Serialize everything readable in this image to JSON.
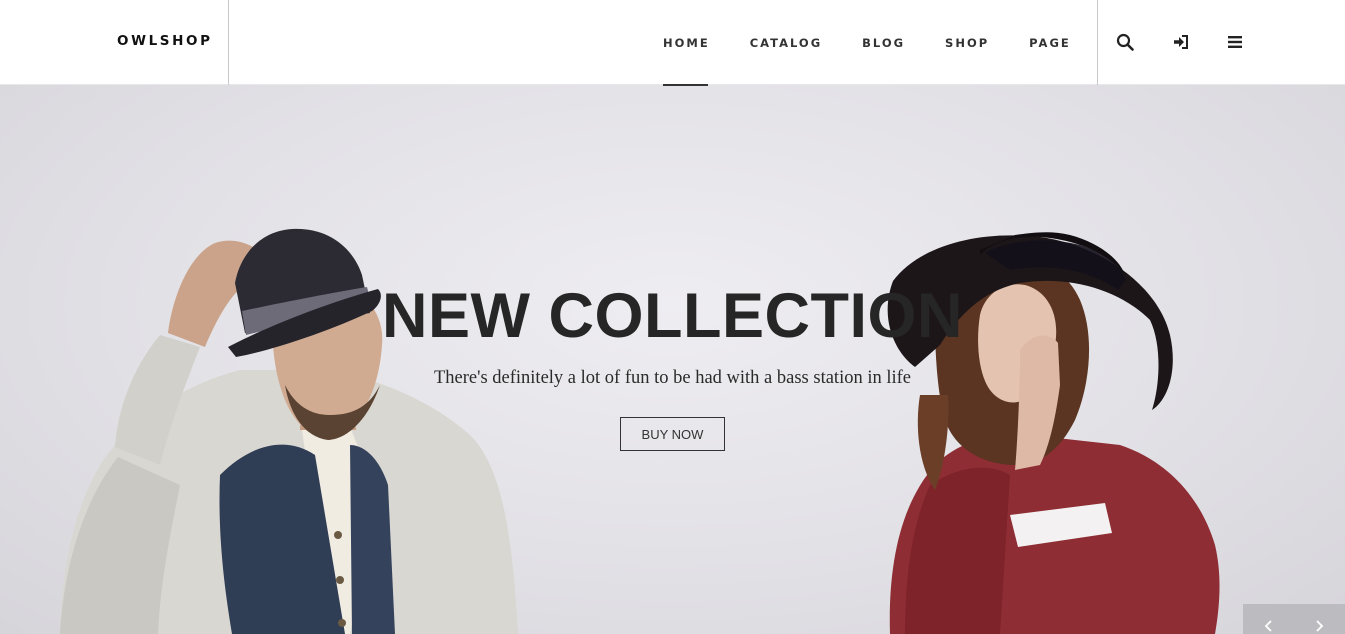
{
  "brand": {
    "logo_text": "OWLSHOP"
  },
  "nav": {
    "items": [
      {
        "label": "HOME",
        "active": true
      },
      {
        "label": "CATALOG",
        "active": false
      },
      {
        "label": "BLOG",
        "active": false
      },
      {
        "label": "SHOP",
        "active": false
      },
      {
        "label": "PAGE",
        "active": false
      }
    ]
  },
  "header_icons": [
    "search-icon",
    "sign-in-icon",
    "menu-icon"
  ],
  "hero": {
    "title": "NEW COLLECTION",
    "subtitle": "There's definitely a lot of fun to be had with a bass station in life",
    "button_label": "BUY NOW"
  },
  "slider": {
    "prev_icon": "chevron-left-icon",
    "next_icon": "chevron-right-icon"
  },
  "colors": {
    "text_dark": "#262626",
    "hero_bg": "#e2e1e6",
    "slider_control_bg": "#bcbcc0"
  }
}
